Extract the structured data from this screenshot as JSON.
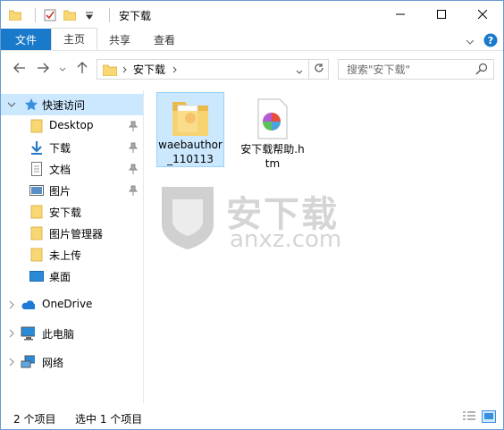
{
  "window": {
    "title": "安下载",
    "caption": {
      "minimize": "minimize-icon",
      "maximize": "maximize-icon",
      "close": "close-icon"
    }
  },
  "ribbon": {
    "tabs": [
      {
        "label": "文件"
      },
      {
        "label": "主页"
      },
      {
        "label": "共享"
      },
      {
        "label": "查看"
      }
    ]
  },
  "address": {
    "path": [
      "安下载"
    ],
    "search_placeholder": "搜索\"安下载\""
  },
  "navpane": {
    "quick_access": "快速访问",
    "items": [
      {
        "label": "Desktop",
        "icon": "folder-icon",
        "pinned": true
      },
      {
        "label": "下载",
        "icon": "download-icon",
        "pinned": true
      },
      {
        "label": "文档",
        "icon": "document-icon",
        "pinned": true
      },
      {
        "label": "图片",
        "icon": "pictures-icon",
        "pinned": true
      },
      {
        "label": "安下载",
        "icon": "folder-icon",
        "pinned": false
      },
      {
        "label": "图片管理器",
        "icon": "folder-icon",
        "pinned": false
      },
      {
        "label": "未上传",
        "icon": "folder-icon",
        "pinned": false
      },
      {
        "label": "桌面",
        "icon": "desktop-icon",
        "pinned": false
      }
    ],
    "onedrive": "OneDrive",
    "this_pc": "此电脑",
    "network": "网络"
  },
  "files": [
    {
      "name": "waebauthor_110113",
      "icon": "folder-icon",
      "selected": true
    },
    {
      "name": "安下载帮助.htm",
      "icon": "htm-file-icon",
      "selected": false
    }
  ],
  "watermark": {
    "text": "安下载",
    "url": "anxz.com"
  },
  "status": {
    "count": "2 个项目",
    "selection": "选中 1 个项目"
  },
  "colors": {
    "accent": "#1979ca",
    "selection": "#cce8ff",
    "folder": "#f8d775"
  }
}
